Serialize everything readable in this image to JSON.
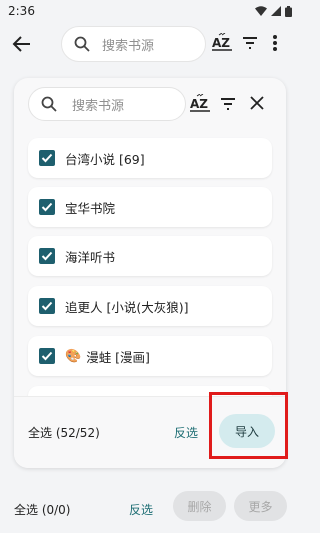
{
  "status_bar": {
    "time": "2:36"
  },
  "topbar": {
    "search_placeholder": "搜索书源"
  },
  "dialog": {
    "search_placeholder": "搜索书源",
    "items": [
      {
        "label": "台湾小说 [69]",
        "checked": true,
        "emoji": ""
      },
      {
        "label": "宝华书院",
        "checked": true,
        "emoji": ""
      },
      {
        "label": "海洋听书",
        "checked": true,
        "emoji": ""
      },
      {
        "label": "追更人 [小说(大灰狼)]",
        "checked": true,
        "emoji": ""
      },
      {
        "label": "漫蛙 [漫画]",
        "checked": true,
        "emoji": "🎨"
      }
    ],
    "footer": {
      "select_all": "全选 (52/52)",
      "invert": "反选",
      "import": "导入"
    }
  },
  "bottom_bar": {
    "select_all": "全选 (0/0)",
    "invert": "反选",
    "delete": "删除",
    "more": "更多"
  },
  "colors": {
    "accent": "#1e5f6e",
    "import_bg": "#d4ebee",
    "highlight": "#e01b1b"
  }
}
